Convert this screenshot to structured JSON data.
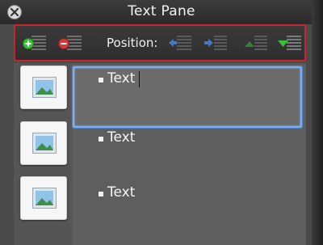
{
  "window": {
    "title": "Text Pane"
  },
  "toolbar": {
    "position_label": "Position:",
    "buttons": [
      {
        "name": "add-item-button",
        "icon": "add-list-icon"
      },
      {
        "name": "remove-item-button",
        "icon": "remove-list-icon"
      },
      {
        "name": "move-left-button",
        "icon": "arrow-left-list-icon"
      },
      {
        "name": "move-right-button",
        "icon": "arrow-right-list-icon"
      },
      {
        "name": "move-up-button",
        "icon": "arrow-up-list-icon"
      },
      {
        "name": "move-down-button",
        "icon": "arrow-down-list-icon"
      }
    ]
  },
  "items": [
    {
      "text": "Text",
      "selected": true
    },
    {
      "text": "Text",
      "selected": false
    },
    {
      "text": "Text",
      "selected": false
    }
  ],
  "colors": {
    "highlight_border": "#7aaef0",
    "toolbar_outline": "#c9232d",
    "add_green": "#3bbf3b",
    "remove_red": "#d23b3b",
    "arrow_blue": "#4f8fe8"
  }
}
